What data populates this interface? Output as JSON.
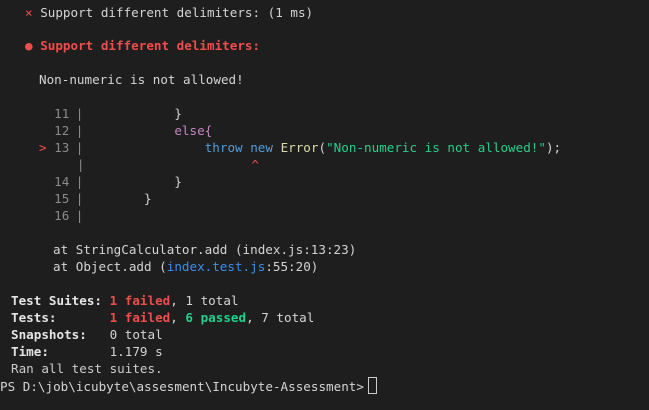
{
  "terminal": {
    "fail_summary": {
      "mark": "×",
      "text": "Support different delimiters: (1 ms)"
    },
    "fail_header": {
      "bullet": "●",
      "text": "Support different delimiters:"
    },
    "error_message": "Non-numeric is not allowed!",
    "code_frame": {
      "lines": [
        {
          "num": "11",
          "text": "            }"
        },
        {
          "num": "12",
          "text": "            else{"
        },
        {
          "num": "13",
          "marker": ">",
          "keyword_throw": "throw",
          "keyword_new": "new",
          "class_name": "Error",
          "string_literal": "\"Non-numeric is not allowed!\"",
          "paren_open": "(",
          "paren_close": ");"
        },
        {
          "caret": "^"
        },
        {
          "num": "14",
          "text": "            }"
        },
        {
          "num": "15",
          "text": "        }"
        },
        {
          "num": "16",
          "text": ""
        }
      ]
    },
    "stack": {
      "frame1": "at StringCalculator.add (index.js:13:23)",
      "frame2_prefix": "at Object.add (",
      "frame2_link": "index.test.js",
      "frame2_suffix": ":55:20)"
    },
    "summary": {
      "suites_label": "Test Suites:",
      "suites_failed": "1 failed",
      "suites_total": ", 1 total",
      "tests_label": "Tests:",
      "tests_failed": "1 failed",
      "tests_sep": ", ",
      "tests_passed": "6 passed",
      "tests_total": ", 7 total",
      "snapshots_label": "Snapshots:",
      "snapshots_value": "0 total",
      "time_label": "Time:",
      "time_value": "1.179 s",
      "ran": "Ran all test suites."
    },
    "prompt": "PS D:\\job\\icubyte\\assesment\\Incubyte-Assessment>"
  },
  "colors": {
    "background": "#1e1e1e",
    "failed": "#f14c4c",
    "passed": "#23d18b",
    "link": "#3b8eea"
  }
}
